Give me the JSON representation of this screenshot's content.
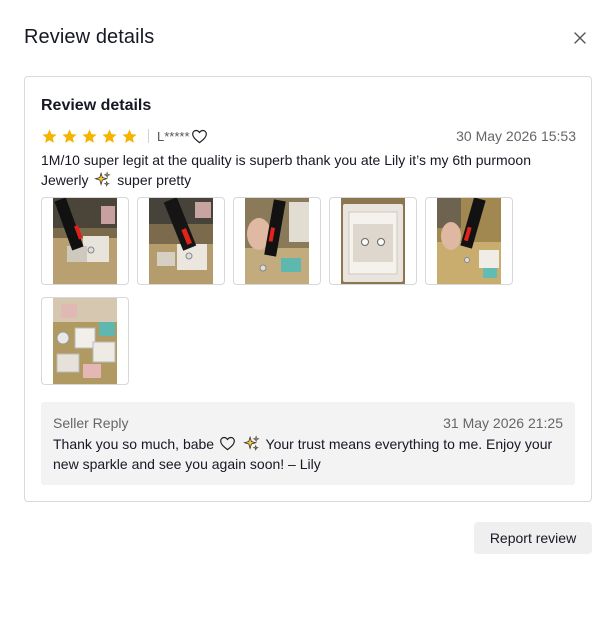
{
  "dialog": {
    "title": "Review details",
    "close_icon": "close-icon"
  },
  "review": {
    "section_title": "Review details",
    "rating": 5,
    "rating_max": 5,
    "star_color": "#F5B400",
    "reviewer": "L*****",
    "reviewer_icon": "heart-outline-icon",
    "date": "30 May 2026 15:53",
    "text_part1": "1M/10 super legit at the quality is superb thank you ate Lily it’s my 6th purmoon Jewerly",
    "text_icon": "sparkles-icon",
    "text_part2": "super pretty",
    "photos": [
      {
        "name": "review-photo-1",
        "subject": "diamond-tester-on-ring"
      },
      {
        "name": "review-photo-2",
        "subject": "diamond-tester-on-ring"
      },
      {
        "name": "review-photo-3",
        "subject": "diamond-tester-in-hand"
      },
      {
        "name": "review-photo-4",
        "subject": "earrings-in-box"
      },
      {
        "name": "review-photo-5",
        "subject": "diamond-tester-on-earrings"
      },
      {
        "name": "review-photo-6",
        "subject": "jewelry-boxes-on-table"
      }
    ]
  },
  "seller_reply": {
    "label": "Seller Reply",
    "date": "31 May 2026 21:25",
    "text_part1": "Thank you so much, babe",
    "heart_icon": "heart-outline-icon",
    "sparkle_icon": "sparkles-icon",
    "text_part2": "Your trust means everything to me. Enjoy your new sparkle and see you again soon! – Lily"
  },
  "actions": {
    "report_label": "Report review"
  }
}
